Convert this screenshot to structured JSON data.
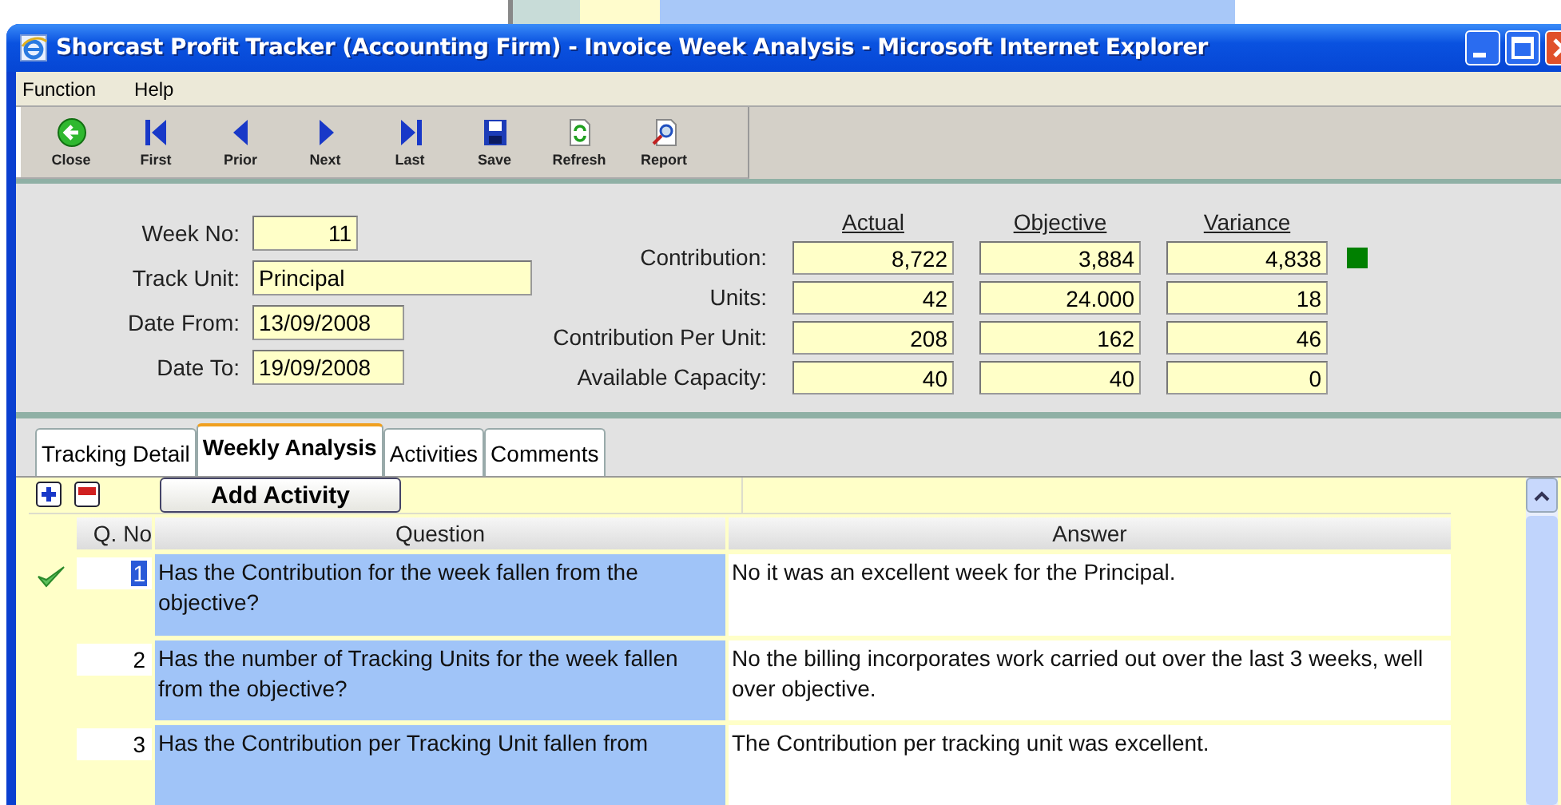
{
  "window": {
    "title": "Shorcast Profit Tracker (Accounting Firm) - Invoice Week Analysis - Microsoft Internet Explorer"
  },
  "menu": [
    "Function",
    "Help"
  ],
  "toolbar": [
    {
      "label": "Close",
      "kind": "close"
    },
    {
      "label": "First",
      "kind": "first"
    },
    {
      "label": "Prior",
      "kind": "prior"
    },
    {
      "label": "Next",
      "kind": "next"
    },
    {
      "label": "Last",
      "kind": "last"
    },
    {
      "label": "Save",
      "kind": "save"
    },
    {
      "label": "Refresh",
      "kind": "refresh"
    },
    {
      "label": "Report",
      "kind": "report"
    }
  ],
  "fields": [
    {
      "label": "Week No:",
      "value": "11",
      "kind": "number"
    },
    {
      "label": "Track Unit:",
      "value": "Principal",
      "kind": "text"
    },
    {
      "label": "Date From:",
      "value": "13/09/2008",
      "kind": "date"
    },
    {
      "label": "Date To:",
      "value": "19/09/2008",
      "kind": "date"
    }
  ],
  "metrics": {
    "columns": [
      "Actual",
      "Objective",
      "Variance"
    ],
    "rows": [
      {
        "label": "Contribution:",
        "values": [
          "8,722",
          "3,884",
          "4,838"
        ],
        "color": "#008000"
      },
      {
        "label": "Units:",
        "values": [
          "42",
          "24.000",
          "18"
        ]
      },
      {
        "label": "Contribution Per Unit:",
        "values": [
          "208",
          "162",
          "46"
        ]
      },
      {
        "label": "Available Capacity:",
        "values": [
          "40",
          "40",
          "0"
        ]
      }
    ]
  },
  "tabs": [
    {
      "label": "Tracking Detail",
      "selected": false
    },
    {
      "label": "Weekly Analysis",
      "selected": true
    },
    {
      "label": "Activities",
      "selected": false
    },
    {
      "label": "Comments",
      "selected": false
    }
  ],
  "grid": {
    "button": "Add Activity",
    "columns": [
      "Q. No",
      "Question",
      "Answer"
    ],
    "rows": [
      {
        "number": "1",
        "question": "Has the Contribution for the week fallen from the objective?",
        "answer": "No it was an excellent week for the Principal.",
        "selected": true
      },
      {
        "number": "2",
        "question": "Has the number of Tracking Units for the week fallen from the objective?",
        "answer": "No the billing incorporates work carried out over the last 3 weeks, well over objective.",
        "selected": false
      },
      {
        "number": "3",
        "question": "Has the Contribution per Tracking Unit fallen from",
        "answer": "The Contribution per tracking unit was excellent.",
        "selected": false
      }
    ]
  }
}
